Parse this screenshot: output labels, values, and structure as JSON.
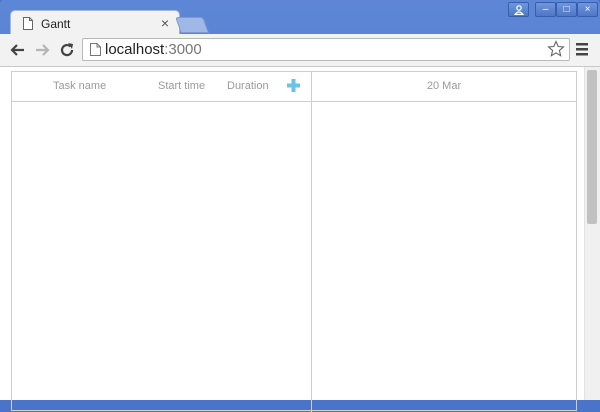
{
  "browser": {
    "tab": {
      "title": "Gantt",
      "close": "×"
    },
    "window_controls": {
      "minimize": "–",
      "maximize": "□",
      "close": "×"
    },
    "address": {
      "host": "localhost",
      "port": ":3000"
    }
  },
  "gantt": {
    "columns": {
      "task_name": "Task name",
      "start_time": "Start time",
      "duration": "Duration"
    },
    "scale": {
      "label": "20 Mar"
    }
  },
  "colors": {
    "accent": "#69c3e8",
    "frame": "#4a74c9"
  },
  "icons": [
    "page-icon",
    "back-arrow-icon",
    "forward-arrow-icon",
    "reload-icon",
    "star-icon",
    "menu-icon",
    "plus-icon",
    "profile-icon"
  ]
}
